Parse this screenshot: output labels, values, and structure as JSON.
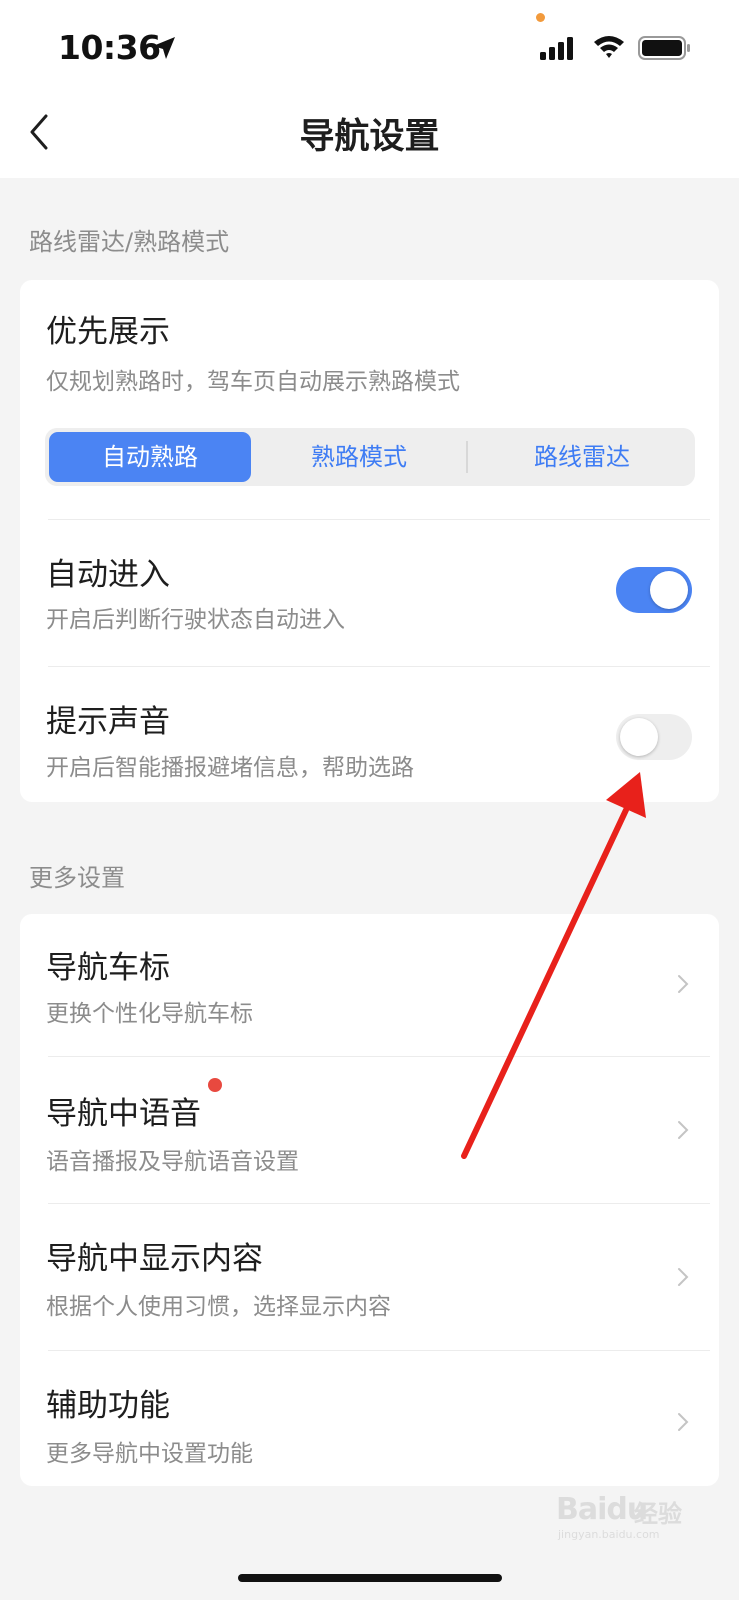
{
  "status_bar": {
    "time": "10:36",
    "icons": [
      "location-arrow-icon",
      "cellular-signal-icon",
      "wifi-icon",
      "battery-icon"
    ]
  },
  "nav": {
    "title": "导航设置",
    "back_icon": "chevron-left-icon"
  },
  "section1": {
    "title": "路线雷达/熟路模式",
    "priority": {
      "title": "优先展示",
      "subtitle": "仅规划熟路时，驾车页自动展示熟路模式",
      "options": [
        {
          "label": "自动熟路",
          "selected": true
        },
        {
          "label": "熟路模式",
          "selected": false
        },
        {
          "label": "路线雷达",
          "selected": false
        }
      ]
    },
    "auto_enter": {
      "title": "自动进入",
      "subtitle": "开启后判断行驶状态自动进入",
      "enabled": true
    },
    "sound": {
      "title": "提示声音",
      "subtitle": "开启后智能播报避堵信息，帮助选路",
      "enabled": false
    }
  },
  "section2": {
    "title": "更多设置",
    "items": [
      {
        "title": "导航车标",
        "subtitle": "更换个性化导航车标",
        "badge": false
      },
      {
        "title": "导航中语音",
        "subtitle": "语音播报及导航语音设置",
        "badge": true
      },
      {
        "title": "导航中显示内容",
        "subtitle": "根据个人使用习惯，选择显示内容",
        "badge": false
      },
      {
        "title": "辅助功能",
        "subtitle": "更多导航中设置功能",
        "badge": false
      }
    ]
  },
  "colors": {
    "accent": "#4b84f3",
    "badge": "#e8493f",
    "annotation_arrow": "#e8211b"
  },
  "watermark": {
    "logo": "Baidu",
    "cn": "经验",
    "sub": "jingyan.baidu.com"
  }
}
